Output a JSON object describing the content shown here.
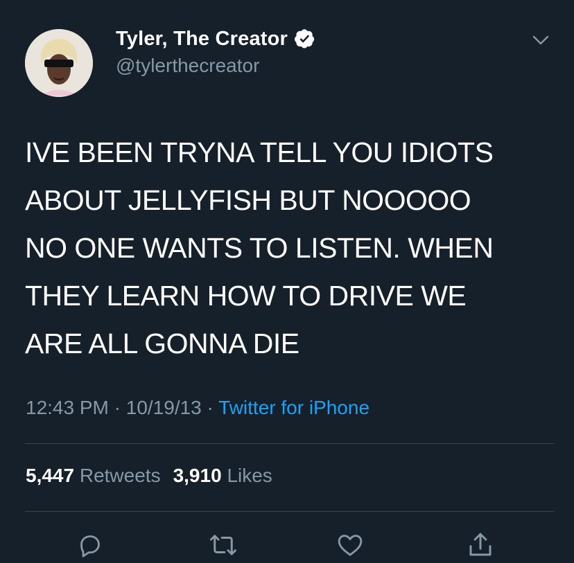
{
  "header": {
    "display_name": "Tyler, The Creator",
    "handle": "@tylerthecreator"
  },
  "tweet": {
    "text": "IVE BEEN TRYNA TELL YOU IDIOTS\nABOUT JELLYFISH BUT NOOOOO\nNO ONE WANTS TO LISTEN. WHEN\nTHEY LEARN HOW TO DRIVE WE\nARE ALL GONNA DIE",
    "time": "12:43 PM",
    "date": "10/19/13",
    "separator": "·",
    "source": "Twitter for iPhone"
  },
  "stats": {
    "retweets_count": "5,447",
    "retweets_label": "Retweets",
    "likes_count": "3,910",
    "likes_label": "Likes"
  },
  "icons": {
    "verified": "verified-badge-icon",
    "more": "chevron-down-icon",
    "reply": "reply-icon",
    "retweet": "retweet-icon",
    "like": "heart-icon",
    "share": "share-icon"
  },
  "colors": {
    "background": "#15202b",
    "text_primary": "#ffffff",
    "text_secondary": "#8899a6",
    "link": "#1da1f2",
    "divider": "#38444d"
  }
}
